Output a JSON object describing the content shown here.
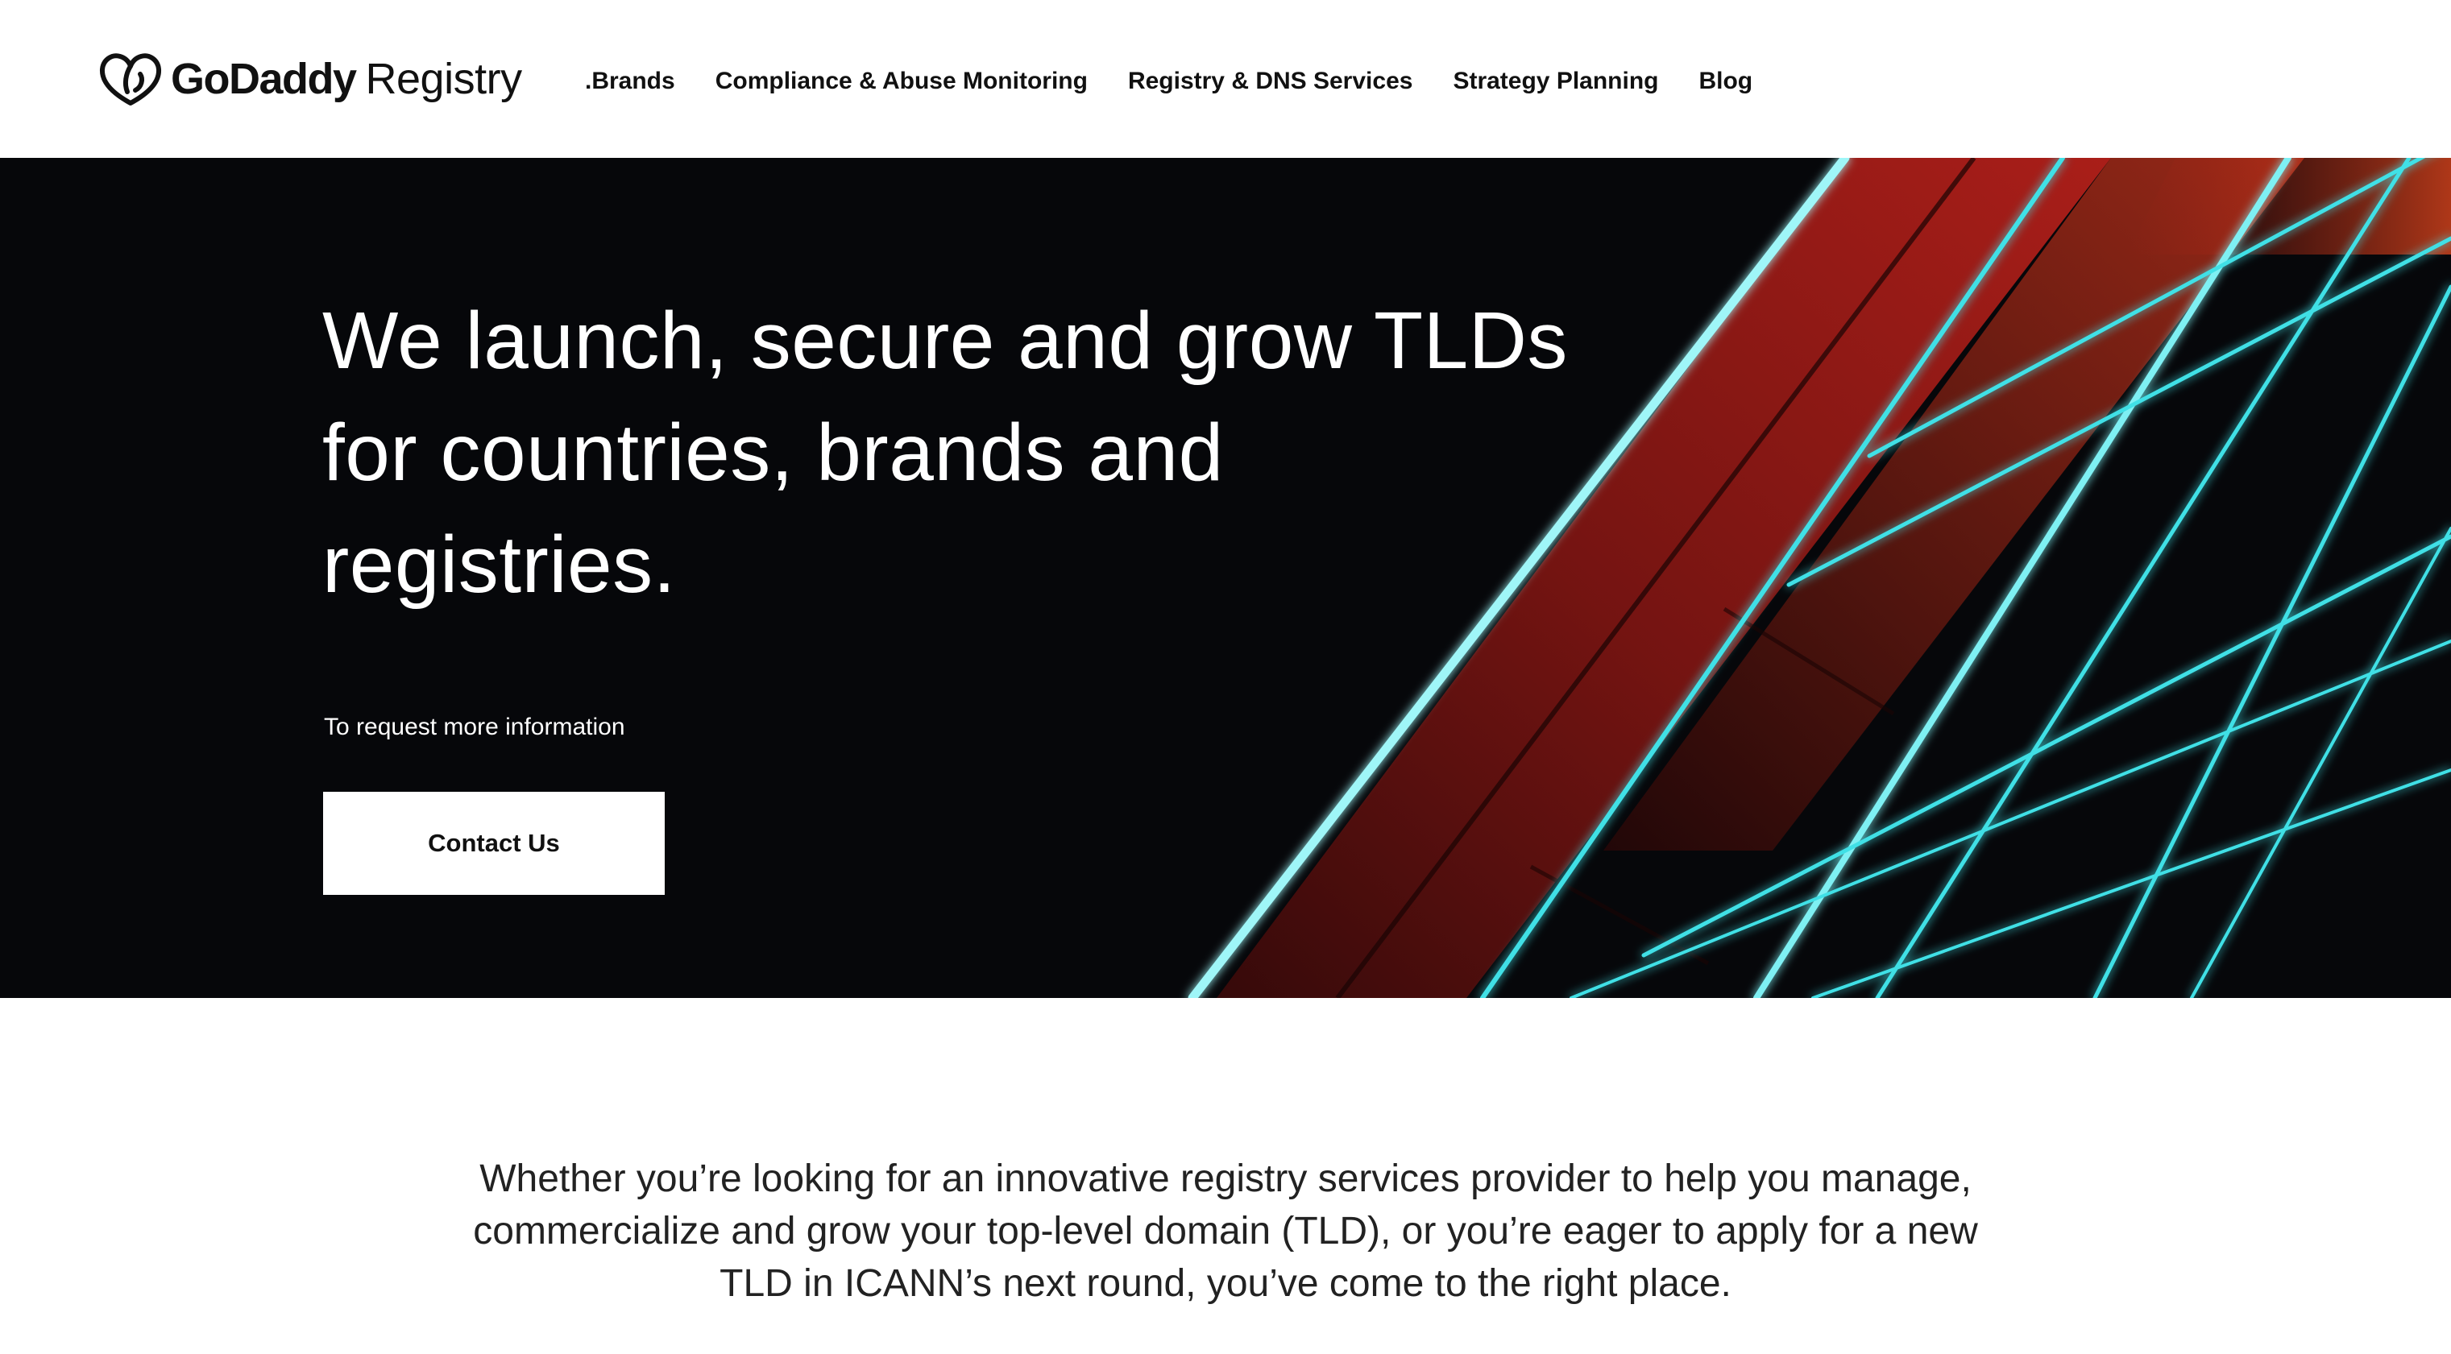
{
  "header": {
    "logo": {
      "brand": "GoDaddy",
      "suffix": "Registry",
      "icon": "godaddy-heart-logo-icon"
    },
    "nav": [
      {
        "label": ".Brands"
      },
      {
        "label": "Compliance & Abuse Monitoring"
      },
      {
        "label": "Registry & DNS Services"
      },
      {
        "label": "Strategy Planning"
      },
      {
        "label": "Blog"
      }
    ]
  },
  "hero": {
    "title": "We launch, secure and grow TLDs for countries, brands and registries.",
    "subtext": "To request more information",
    "cta_label": "Contact Us",
    "background": "abstract-neon-architecture-image"
  },
  "intro": {
    "text": "Whether you’re looking for an innovative registry services provider to help you manage, commercialize and grow your top-level domain (TLD), or you’re eager to apply for a new TLD in ICANN’s next round, you’ve come to the right place."
  },
  "colors": {
    "hero_background": "#06070a",
    "neon_teal": "#3fe0e6",
    "neon_red": "#c41f1a",
    "text_dark": "#111111"
  }
}
